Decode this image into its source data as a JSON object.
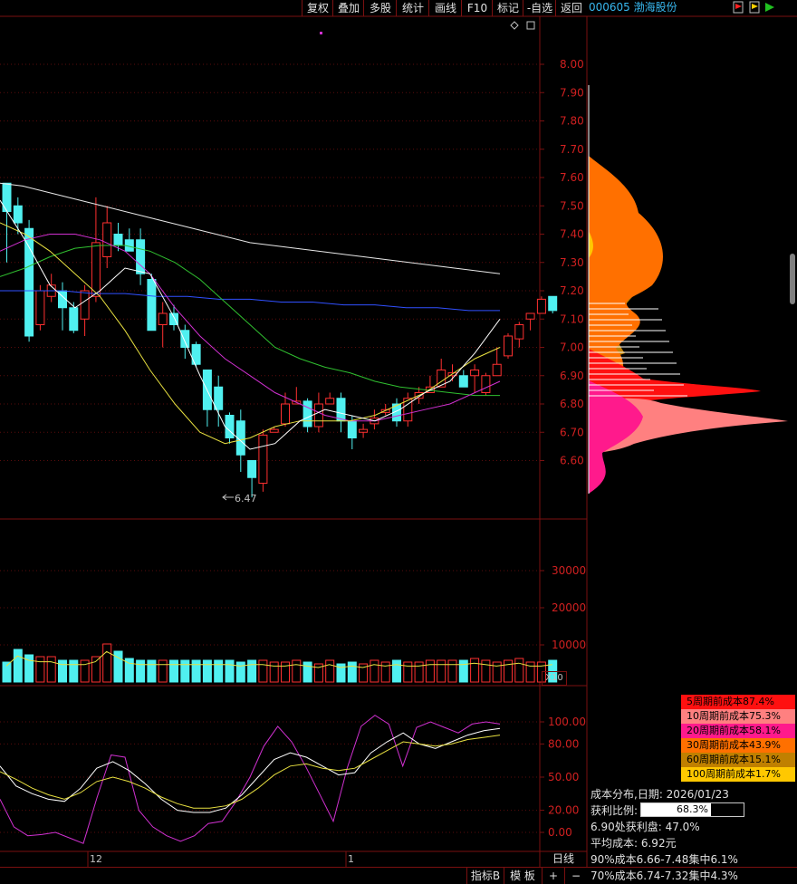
{
  "toolbar": {
    "buttons": [
      "复权",
      "叠加",
      "多股",
      "统计",
      "画线",
      "F10",
      "标记",
      "-自选",
      "返回"
    ]
  },
  "stock": {
    "code_name": "000605 渤海股份"
  },
  "price_axis": {
    "ticks": [
      "8.00",
      "7.90",
      "7.80",
      "7.70",
      "7.60",
      "7.50",
      "7.40",
      "7.30",
      "7.20",
      "7.10",
      "7.00",
      "6.90",
      "6.80",
      "6.70",
      "6.60"
    ]
  },
  "volume_axis": {
    "ticks": [
      "30000",
      "20000",
      "10000"
    ],
    "multiplier": "X10"
  },
  "indicator_axis": {
    "ticks": [
      "100.00",
      "80.00",
      "50.00",
      "20.00",
      "0.00"
    ]
  },
  "annotation": {
    "low_label": "6.47"
  },
  "date_labels": {
    "month_dec": "12",
    "month_jan": "1",
    "period": "日线"
  },
  "bottom_tabs": [
    "指标B",
    "模 板",
    "+",
    "−"
  ],
  "cost_legend": [
    {
      "label": "5周期前成本87.4%",
      "color": "#ff1010"
    },
    {
      "label": "10周期前成本75.3%",
      "color": "#ff8080"
    },
    {
      "label": "20周期前成本58.1%",
      "color": "#ff1a8c"
    },
    {
      "label": "30周期前成本43.9%",
      "color": "#ff7000"
    },
    {
      "label": "60周期前成本15.1%",
      "color": "#c08000"
    },
    {
      "label": "100周期前成本1.7%",
      "color": "#ffc800"
    }
  ],
  "cost_info": {
    "date_line": "成本分布,日期:  2026/01/23",
    "profit_label": "获利比例:",
    "profit_value": "68.3%",
    "profit_fraction": 0.683,
    "line_690": "6.90处获利盘:  47.0%",
    "avg_cost": "平均成本:  6.92元",
    "cost90": "90%成本6.66-7.48集中6.1%",
    "cost70": "70%成本6.74-7.32集中4.3%"
  },
  "colors": {
    "up": "#ff3030",
    "down": "#50f0f0",
    "frame": "#7a1010"
  },
  "chart_data": {
    "type": "candlestick",
    "price_unit": "CNY",
    "ylim": [
      6.47,
      8.05
    ],
    "candles": [
      [
        7.58,
        7.48,
        7.58,
        7.3
      ],
      [
        7.5,
        7.44,
        7.53,
        7.4
      ],
      [
        7.42,
        7.04,
        7.45,
        7.02
      ],
      [
        7.08,
        7.2,
        7.22,
        7.06
      ],
      [
        7.18,
        7.22,
        7.26,
        7.16
      ],
      [
        7.2,
        7.14,
        7.23,
        7.06
      ],
      [
        7.14,
        7.06,
        7.16,
        7.05
      ],
      [
        7.1,
        7.2,
        7.22,
        7.04
      ],
      [
        7.18,
        7.37,
        7.53,
        7.16
      ],
      [
        7.32,
        7.44,
        7.5,
        7.28
      ],
      [
        7.4,
        7.36,
        7.44,
        7.34
      ],
      [
        7.38,
        7.34,
        7.42,
        7.34
      ],
      [
        7.38,
        7.26,
        7.42,
        7.22
      ],
      [
        7.24,
        7.06,
        7.26,
        7.06
      ],
      [
        7.08,
        7.12,
        7.16,
        7.0
      ],
      [
        7.12,
        7.08,
        7.15,
        7.06
      ],
      [
        7.06,
        7.0,
        7.08,
        6.96
      ],
      [
        7.01,
        6.94,
        7.02,
        6.93
      ],
      [
        6.92,
        6.78,
        6.92,
        6.72
      ],
      [
        6.86,
        6.78,
        6.9,
        6.72
      ],
      [
        6.76,
        6.68,
        6.77,
        6.66
      ],
      [
        6.74,
        6.62,
        6.78,
        6.56
      ],
      [
        6.6,
        6.54,
        6.6,
        6.47
      ],
      [
        6.52,
        6.69,
        6.71,
        6.49
      ],
      [
        6.7,
        6.71,
        6.72,
        6.7
      ],
      [
        6.73,
        6.8,
        6.84,
        6.72
      ],
      [
        6.8,
        6.81,
        6.86,
        6.8
      ],
      [
        6.81,
        6.72,
        6.82,
        6.7
      ],
      [
        6.72,
        6.8,
        6.84,
        6.7
      ],
      [
        6.8,
        6.82,
        6.84,
        6.8
      ],
      [
        6.82,
        6.74,
        6.84,
        6.7
      ],
      [
        6.74,
        6.68,
        6.76,
        6.64
      ],
      [
        6.7,
        6.71,
        6.73,
        6.68
      ],
      [
        6.73,
        6.75,
        6.78,
        6.71
      ],
      [
        6.77,
        6.78,
        6.8,
        6.76
      ],
      [
        6.8,
        6.74,
        6.82,
        6.72
      ],
      [
        6.74,
        6.82,
        6.84,
        6.72
      ],
      [
        6.82,
        6.84,
        6.86,
        6.8
      ],
      [
        6.84,
        6.86,
        6.9,
        6.84
      ],
      [
        6.86,
        6.92,
        6.96,
        6.86
      ],
      [
        6.9,
        6.91,
        6.94,
        6.88
      ],
      [
        6.9,
        6.86,
        6.92,
        6.86
      ],
      [
        6.9,
        6.92,
        6.94,
        6.84
      ],
      [
        6.84,
        6.9,
        6.91,
        6.83
      ],
      [
        6.9,
        6.94,
        7.0,
        6.9
      ],
      [
        6.97,
        7.04,
        7.05,
        6.96
      ],
      [
        7.03,
        7.08,
        7.09,
        7.0
      ],
      [
        7.1,
        7.12,
        7.12,
        7.06
      ],
      [
        7.12,
        7.17,
        7.18,
        7.12
      ],
      [
        7.18,
        7.13,
        7.18,
        7.12
      ]
    ],
    "ma_lines": {
      "white_long": [
        7.58,
        7.57,
        7.55,
        7.53,
        7.51,
        7.49,
        7.47,
        7.45,
        7.43,
        7.41,
        7.39,
        7.37,
        7.36,
        7.35,
        7.34,
        7.33,
        7.32,
        7.31,
        7.3,
        7.29,
        7.28,
        7.27,
        7.26
      ],
      "blue": [
        7.2,
        7.2,
        7.2,
        7.19,
        7.19,
        7.18,
        7.18,
        7.17,
        7.17,
        7.16,
        7.16,
        7.15,
        7.15,
        7.14,
        7.14,
        7.13,
        7.13
      ],
      "green": [
        7.25,
        7.28,
        7.32,
        7.35,
        7.36,
        7.36,
        7.34,
        7.3,
        7.24,
        7.16,
        7.08,
        7.0,
        6.96,
        6.93,
        6.91,
        6.88,
        6.86,
        6.85,
        6.84,
        6.83,
        6.83
      ],
      "magenta": [
        7.34,
        7.38,
        7.4,
        7.4,
        7.38,
        7.34,
        7.26,
        7.14,
        7.04,
        6.96,
        6.9,
        6.84,
        6.8,
        6.76,
        6.74,
        6.74,
        6.76,
        6.78,
        6.8,
        6.84,
        6.88
      ],
      "yellow": [
        7.44,
        7.4,
        7.34,
        7.26,
        7.18,
        7.06,
        6.92,
        6.8,
        6.7,
        6.66,
        6.68,
        6.72,
        6.74,
        6.74,
        6.74,
        6.76,
        6.8,
        6.84,
        6.9,
        6.96,
        7.0
      ],
      "white_short": [
        7.52,
        7.38,
        7.22,
        7.14,
        7.2,
        7.28,
        7.26,
        7.1,
        6.9,
        6.72,
        6.64,
        6.66,
        6.74,
        6.78,
        6.76,
        6.74,
        6.78,
        6.84,
        6.88,
        6.98,
        7.1
      ]
    },
    "volume": [
      22,
      36,
      30,
      28,
      28,
      24,
      24,
      24,
      28,
      42,
      34,
      26,
      24,
      24,
      24,
      24,
      24,
      24,
      24,
      24,
      24,
      22,
      24,
      24,
      22,
      22,
      24,
      22,
      20,
      24,
      20,
      22,
      20,
      24,
      22,
      24,
      22,
      22,
      24,
      24,
      24,
      24,
      26,
      24,
      22,
      24,
      26,
      22,
      22,
      24
    ],
    "indicator": {
      "magenta": [
        30,
        5,
        -3,
        -2,
        0,
        -5,
        -10,
        32,
        70,
        68,
        20,
        5,
        -3,
        -8,
        -3,
        8,
        10,
        28,
        50,
        78,
        96,
        82,
        60,
        35,
        10,
        58,
        96,
        106,
        98,
        60,
        95,
        100,
        95,
        90,
        98,
        100,
        98
      ],
      "white": [
        60,
        42,
        35,
        30,
        28,
        40,
        58,
        64,
        56,
        44,
        30,
        20,
        18,
        18,
        22,
        34,
        50,
        66,
        72,
        68,
        60,
        52,
        54,
        72,
        82,
        90,
        80,
        76,
        82,
        88,
        92,
        94
      ],
      "yellow": [
        55,
        48,
        40,
        34,
        30,
        36,
        46,
        50,
        46,
        40,
        32,
        26,
        22,
        22,
        24,
        30,
        40,
        52,
        60,
        62,
        58,
        56,
        58,
        66,
        74,
        82,
        80,
        78,
        80,
        84,
        86,
        88
      ]
    }
  }
}
